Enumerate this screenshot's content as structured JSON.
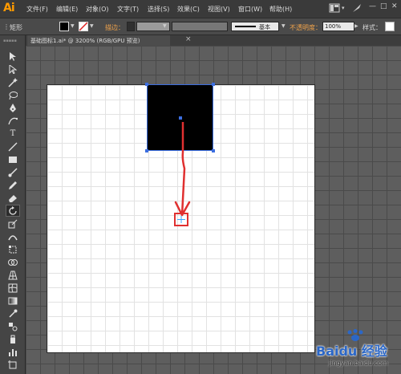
{
  "app": {
    "logo_text": "Ai"
  },
  "menu": {
    "items": [
      "文件(F)",
      "编辑(E)",
      "对象(O)",
      "文字(T)",
      "选择(S)",
      "效果(C)",
      "视图(V)",
      "窗口(W)",
      "帮助(H)"
    ]
  },
  "control": {
    "selection_label": "矩形",
    "fill_color": "#000000",
    "stroke_label": "描边：",
    "stroke_style_label": "基本",
    "opacity_label": "不透明度：",
    "opacity_value": "100%",
    "style_label": "样式："
  },
  "document": {
    "tab_title": "基础图标1.ai* @ 3200% (RGB/GPU 预览)",
    "close_symbol": "×"
  },
  "artwork": {
    "square_color": "#000000",
    "selection_color": "#3c6ee0",
    "annotation_color": "#e03030"
  },
  "watermark": {
    "brand": "Baidu 经验",
    "url": "jingyan.baidu.com"
  },
  "tools": [
    "selection-tool",
    "direct-selection-tool",
    "magic-wand-tool",
    "lasso-tool",
    "pen-tool",
    "curvature-tool",
    "type-tool",
    "line-tool",
    "rectangle-tool",
    "paintbrush-tool",
    "pencil-tool",
    "eraser-tool",
    "rotate-tool",
    "scale-tool",
    "warp-tool",
    "free-transform-tool",
    "shape-builder-tool",
    "perspective-grid-tool",
    "mesh-tool",
    "gradient-tool",
    "eyedropper-tool",
    "blend-tool",
    "symbol-sprayer-tool",
    "column-graph-tool",
    "artboard-tool",
    "slice-tool"
  ]
}
